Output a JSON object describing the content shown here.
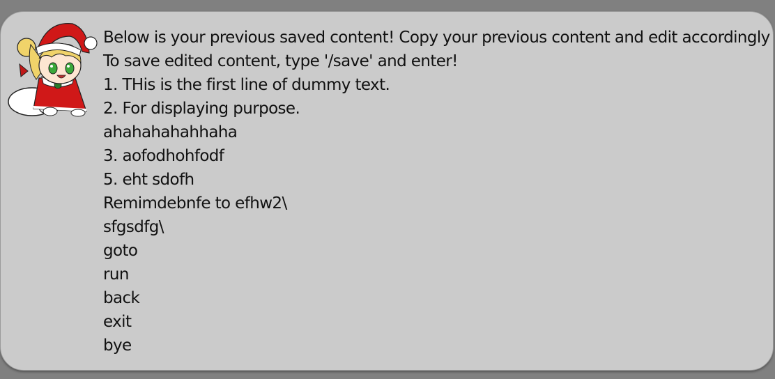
{
  "dialog": {
    "avatar_icon": "santa-chibi-avatar-icon",
    "lines": [
      "Below is your previous saved content! Copy your previous content and edit accordingly",
      "To save edited content, type '/save' and enter!",
      "1. THis is the first line of dummy text.",
      "2. For displaying purpose.",
      "ahahahahahhaha",
      "3. aofodhohfodf",
      "5. eht sdofh",
      "Remimdebnfe to efhw2\\",
      "sfgsdfg\\",
      "goto",
      "run",
      "back",
      "exit",
      "bye"
    ]
  },
  "colors": {
    "background": "#808080",
    "bubble": "#cbcbcb",
    "text": "#111111"
  }
}
